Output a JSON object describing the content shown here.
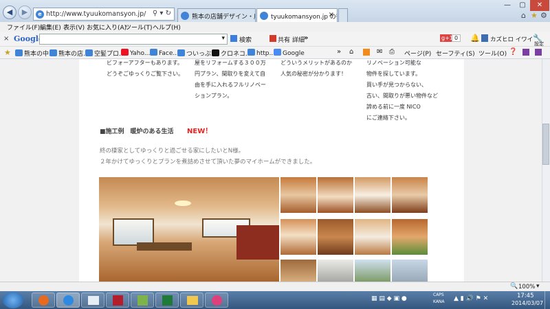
{
  "browser": {
    "address": "http://www.tyuukomansyon.jp/",
    "tabs": [
      {
        "label": "熊本の店舗デザイン・店舗設..."
      },
      {
        "label": "tyuukomansyon.jp の待..."
      }
    ],
    "menu": [
      "ファイル(F)",
      "編集(E)",
      "表示(V)",
      "お気に入り(A)",
      "ツール(T)",
      "ヘルプ(H)"
    ],
    "google_toolbar": {
      "logo": "Google",
      "search_label": "検索",
      "share_label": "共有",
      "more_label": "詳細",
      "more_arrows": "»",
      "gplus_label": "g+1",
      "gplus_count": "0",
      "user_name": "カズヒロ イワイ",
      "settings_label": "設定"
    },
    "favorites": [
      "熊本の中...",
      "熊本の店...",
      "空髪プロ...",
      "Yaho...",
      "Face...",
      "ついっぷ...",
      "クロネコ...",
      "http...",
      "Google"
    ],
    "command_bar": [
      "ページ(P)",
      "セーフティ(S)",
      "ツール(O)"
    ],
    "zoom": "100%"
  },
  "page": {
    "col1": [
      "ビフォーアフターもあります。",
      "どうぞごゆっくりご覧下さい。"
    ],
    "col2": [
      "屋をリフォームする３００万",
      "円プラン、間取りを変えて自",
      "由を手に入れるフルリノベー",
      "ションプラン。"
    ],
    "col3": [
      "どういうメリットがあるのか",
      "人気の秘密が分かります！"
    ],
    "col4": [
      "リノベーション可能な",
      "物件を探しています。",
      "買い手が見つからない、",
      "古い、間取りが悪い物件など",
      "諦める前に一度 NICO",
      "にご連絡下さい。"
    ],
    "section_title": "■施工例　暖炉のある生活",
    "new_badge": "NEW！",
    "desc": [
      "終の棲家としてゆっくりと過ごせる家にしたいとN様。",
      "２年かけてゆっくりとプランを煮詰めさせて頂いた夢のマイホームができました。"
    ]
  },
  "taskbar": {
    "time": "17:45",
    "date": "2014/03/07",
    "caps": "CAPS",
    "kana": "KANA"
  },
  "colors": {
    "new_badge": "#e8211f",
    "wood": "#b8763a",
    "taskbar": "#3c5f86"
  }
}
